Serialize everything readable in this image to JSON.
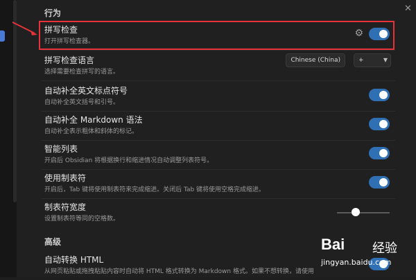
{
  "sections": {
    "behavior": "行为",
    "advanced": "高级"
  },
  "settings": [
    {
      "title": "拼写检查",
      "desc": "打开拼写检查器。",
      "on": true
    },
    {
      "title": "拼写检查语言",
      "desc": "选择需要检查拼写的语言。",
      "language": "Chinese (China)",
      "add": "+"
    },
    {
      "title": "自动补全英文标点符号",
      "desc": "自动补全英文括号和引号。",
      "on": true
    },
    {
      "title": "自动补全 Markdown 语法",
      "desc": "自动补全表示粗体和斜体的标记。",
      "on": true
    },
    {
      "title": "智能列表",
      "desc": "开启后 Obsidian 将根据换行和缩进情况自动调整列表符号。",
      "on": true
    },
    {
      "title": "使用制表符",
      "desc": "开启后，Tab 键将使用制表符来完成缩进。关闭后 Tab 键将使用空格完成缩进。",
      "on": true
    },
    {
      "title": "制表符宽度",
      "desc": "设置制表符等同的空格数。",
      "slider_value": 0.35
    },
    {
      "title": "自动转换 HTML",
      "desc": "从网页粘贴或拖拽粘贴内容时自动将 HTML 格式转换为 Markdown 格式。如果不想转换，请使用",
      "on": true
    }
  ],
  "close_label": "✕",
  "watermark": {
    "logo": "Bai",
    "text": "经验",
    "sub": "jingyan.baidu.com"
  },
  "colors": {
    "toggle_on": "#2f6fb4",
    "highlight": "#e6333a",
    "accent": "#4a79d6"
  }
}
